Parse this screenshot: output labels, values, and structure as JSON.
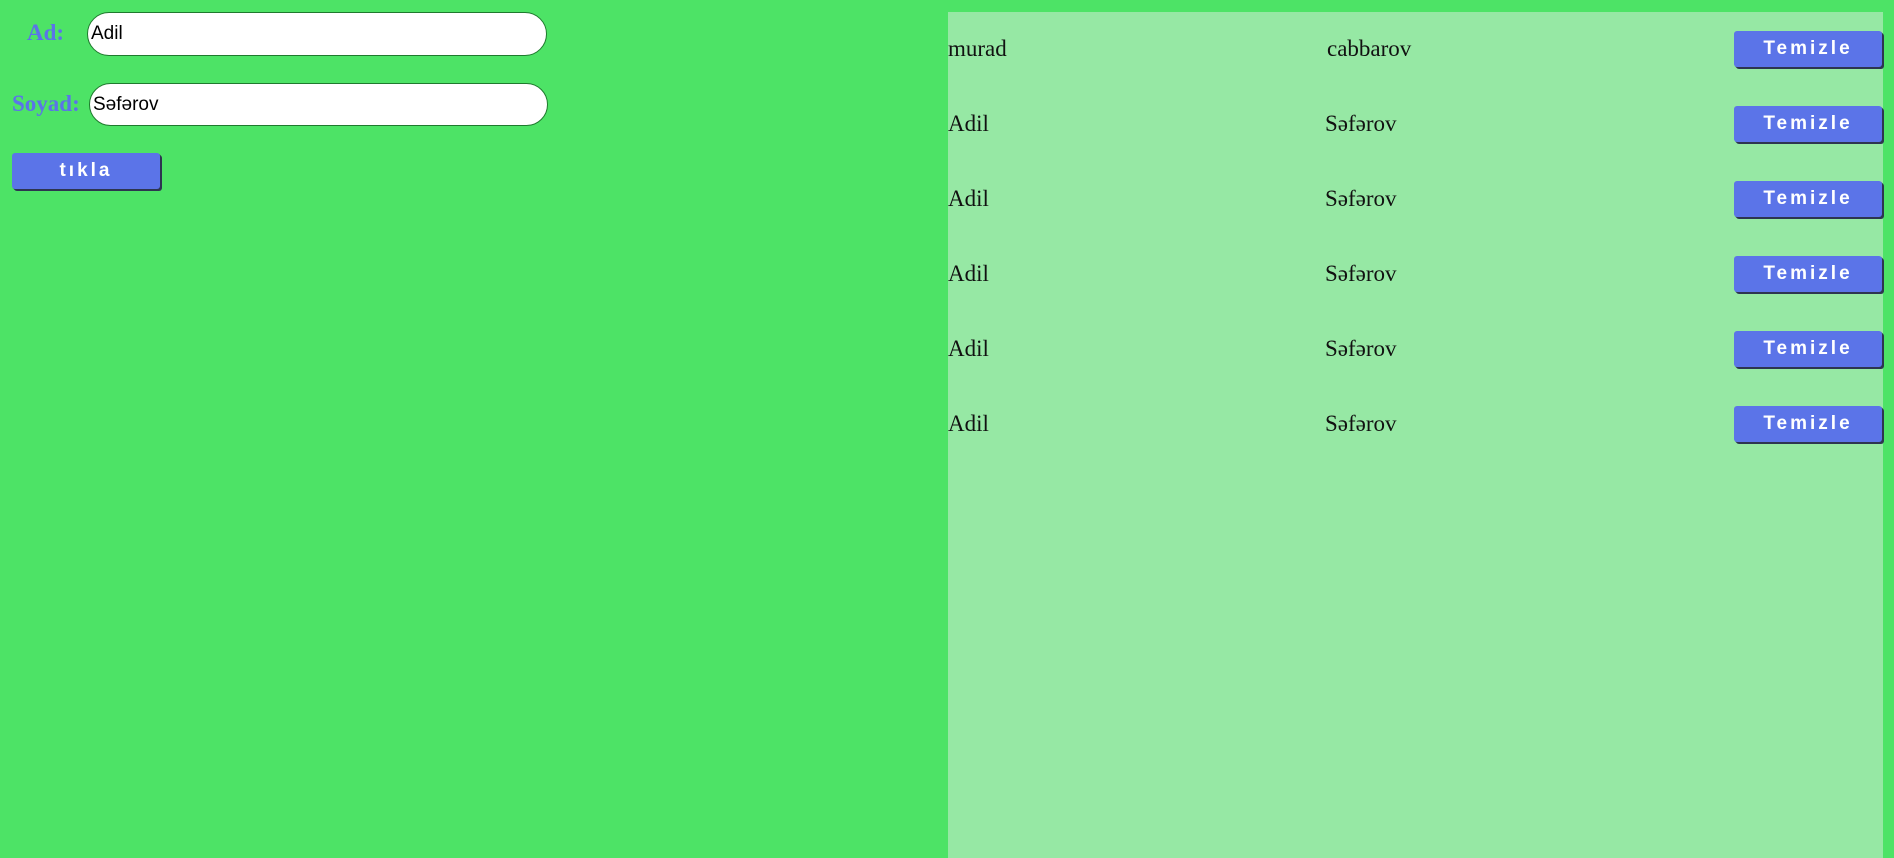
{
  "form": {
    "name_label": "Ad:",
    "name_value": "Adil",
    "surname_label": "Soyad:",
    "surname_value": "Səfərov",
    "submit_label": "tıkla"
  },
  "list": {
    "delete_label": "Temizle",
    "rows": [
      {
        "name": "murad",
        "surname": "cabbarov"
      },
      {
        "name": "Adil",
        "surname": "Səfərov"
      },
      {
        "name": "Adil",
        "surname": "Səfərov"
      },
      {
        "name": "Adil",
        "surname": "Səfərov"
      },
      {
        "name": "Adil",
        "surname": "Səfərov"
      },
      {
        "name": "Adil",
        "surname": "Səfərov"
      }
    ]
  },
  "colors": {
    "page_background": "#4de366",
    "panel_background": "#96e8a4",
    "accent": "#5b74e8"
  }
}
